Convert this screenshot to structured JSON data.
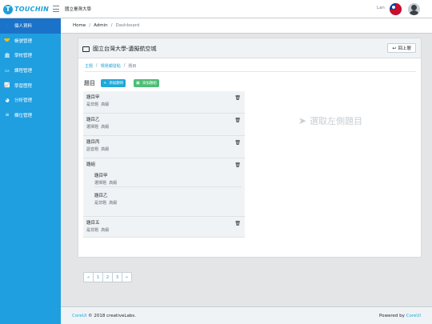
{
  "header": {
    "logo_letter": "T",
    "logo_text": "TOUCHIN",
    "school": "國立臺灣大學",
    "user_name": "Lan",
    "flag": "taiwan-flag-icon",
    "avatar": "user-avatar-icon"
  },
  "sidebar": {
    "items": [
      {
        "icon": "user-icon",
        "glyph": "👤",
        "label": "個人資料"
      },
      {
        "icon": "handshake-icon",
        "glyph": "🤝",
        "label": "帳號管理"
      },
      {
        "icon": "school-icon",
        "glyph": "🏛",
        "label": "學校管理"
      },
      {
        "icon": "screen-icon",
        "glyph": "▭",
        "label": "課程管理"
      },
      {
        "icon": "chart-icon",
        "glyph": "📈",
        "label": "學習歷程"
      },
      {
        "icon": "pie-icon",
        "glyph": "◕",
        "label": "分析管理"
      },
      {
        "icon": "list-icon",
        "glyph": "≡",
        "label": "欄位管理"
      }
    ]
  },
  "breadcrumb": {
    "home": "Home",
    "admin": "Admin",
    "current": "Dashboard"
  },
  "card": {
    "title": "國立台灣大學-遺擬航空城",
    "back_label": "回上層",
    "crumb": {
      "topic": "主題",
      "scene": "場景觸發點",
      "current": "題目"
    }
  },
  "questions": {
    "heading": "題目",
    "add_question": "添加題目",
    "add_group": "添加題組",
    "items": [
      {
        "title": "題目甲",
        "type": "是非題",
        "level": "高級"
      },
      {
        "title": "題目乙",
        "type": "選擇題",
        "level": "高級"
      },
      {
        "title": "題目丙",
        "type": "語音題",
        "level": "高級"
      },
      {
        "title": "題組",
        "sub": [
          {
            "title": "題目甲",
            "type": "選擇題",
            "level": "高級"
          },
          {
            "title": "題目乙",
            "type": "是非題",
            "level": "高級"
          }
        ]
      },
      {
        "title": "題目五",
        "type": "是非題",
        "level": "高級"
      }
    ]
  },
  "pagination": {
    "prev": "«",
    "pages": [
      "1",
      "2",
      "3"
    ],
    "next": "»"
  },
  "placeholder": "選取左側題目",
  "footer": {
    "brand": "CoreUI",
    "copyright": "© 2018 creativeLabs.",
    "powered": "Powered by",
    "powered_brand": "CoreUI"
  }
}
